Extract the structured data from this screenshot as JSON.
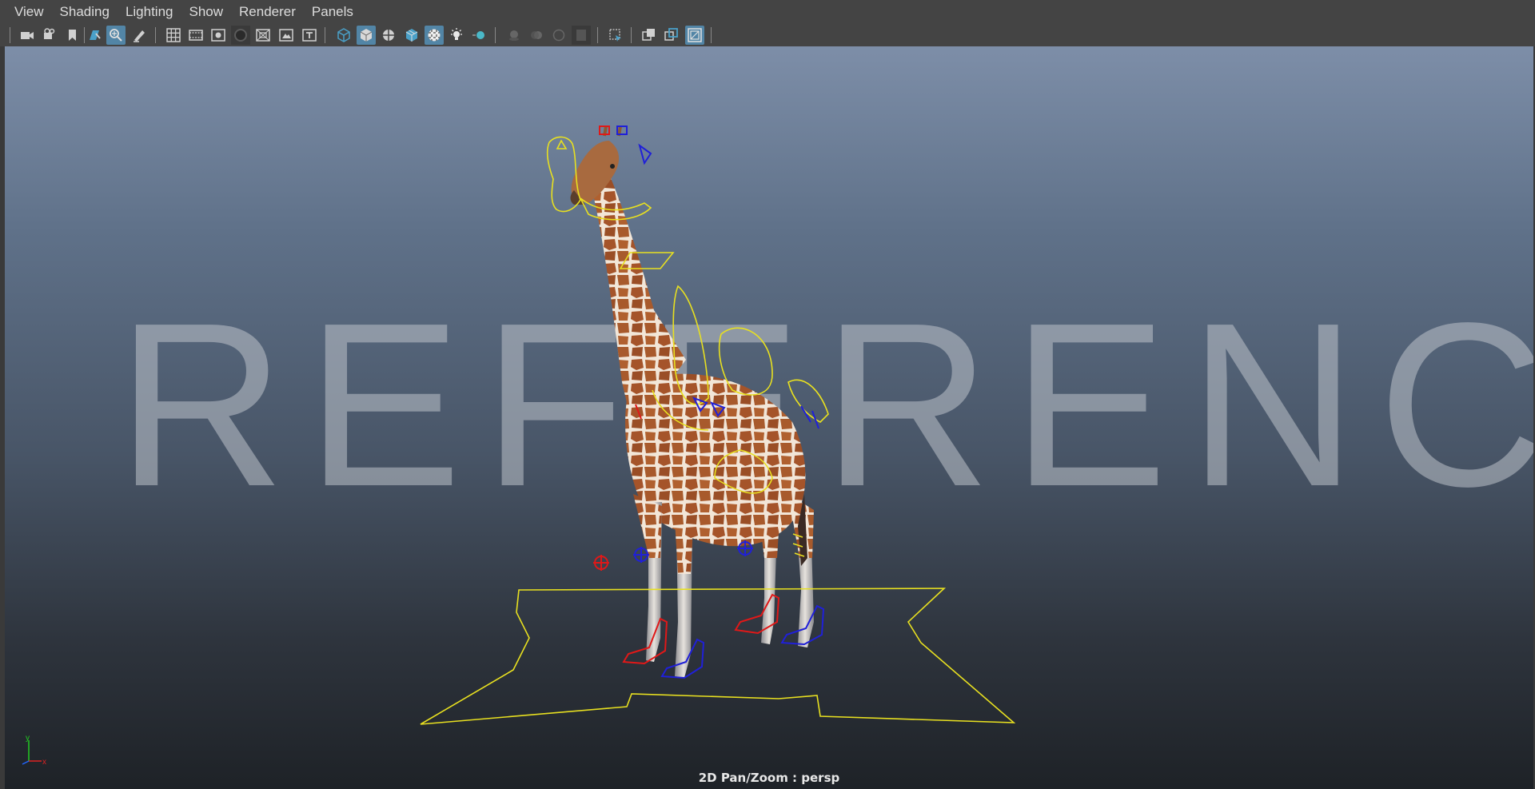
{
  "menubar": {
    "items": [
      "View",
      "Shading",
      "Lighting",
      "Show",
      "Renderer",
      "Panels"
    ]
  },
  "toolbar": {
    "buttons": [
      {
        "icon": "camera-select-icon",
        "active": false
      },
      {
        "icon": "camera-attributes-icon",
        "active": false
      },
      {
        "icon": "bookmark-icon",
        "active": false
      },
      {
        "icon": "image-plane-icon",
        "active": false
      },
      {
        "icon": "pan-zoom-icon",
        "active": true
      },
      {
        "icon": "grease-pencil-icon",
        "active": false
      },
      {
        "icon": "grid-icon",
        "active": false
      },
      {
        "icon": "film-gate-icon",
        "active": false
      },
      {
        "icon": "resolution-gate-icon",
        "active": false
      },
      {
        "icon": "gate-mask-icon",
        "active": false
      },
      {
        "icon": "field-chart-icon",
        "active": false
      },
      {
        "icon": "safe-action-icon",
        "active": false
      },
      {
        "icon": "safe-title-icon",
        "active": false
      },
      {
        "icon": "wireframe-icon",
        "active": false
      },
      {
        "icon": "smooth-shade-icon",
        "active": true
      },
      {
        "icon": "bounding-box-icon",
        "active": false
      },
      {
        "icon": "wireframe-on-shaded-icon",
        "active": false
      },
      {
        "icon": "textured-icon",
        "active": true
      },
      {
        "icon": "use-all-lights-icon",
        "active": false
      },
      {
        "icon": "shadows-icon",
        "active": false
      },
      {
        "icon": "screen-space-ao-icon",
        "active": false
      },
      {
        "icon": "motion-blur-icon",
        "active": false
      },
      {
        "icon": "multisample-aa-icon",
        "active": false
      },
      {
        "icon": "depth-of-field-icon",
        "active": false
      },
      {
        "icon": "isolate-select-icon",
        "active": false
      },
      {
        "icon": "xray-icon",
        "active": false
      },
      {
        "icon": "xray-joints-icon",
        "active": false
      },
      {
        "icon": "xray-active-components-icon",
        "active": true
      }
    ]
  },
  "viewport": {
    "watermark": "REFERENCE",
    "camera_label": "2D Pan/Zoom : persp",
    "axis": {
      "y": "y",
      "x": "x"
    },
    "colors": {
      "controls_yellow": "#e8e020",
      "controls_red": "#e01818",
      "controls_blue": "#2020d8",
      "selection_blue": "#5285a6"
    }
  }
}
